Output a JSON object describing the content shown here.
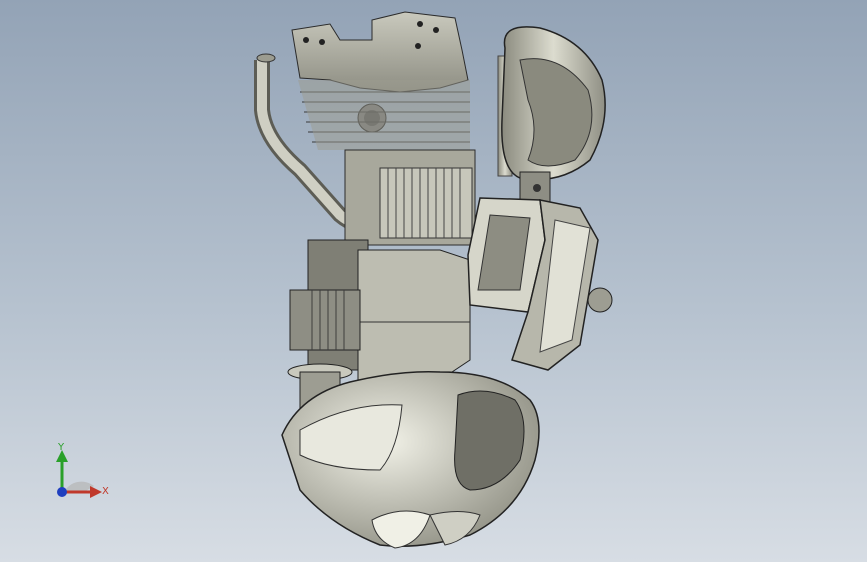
{
  "viewport": {
    "background_top": "#93a3b6",
    "background_bottom": "#d7dde4",
    "model_name": "engine-assembly"
  },
  "triad": {
    "y_label": "Y",
    "x_label": "X",
    "colors": {
      "y": "#2aa02a",
      "x": "#c0392b",
      "z": "#1f3fbf"
    }
  }
}
